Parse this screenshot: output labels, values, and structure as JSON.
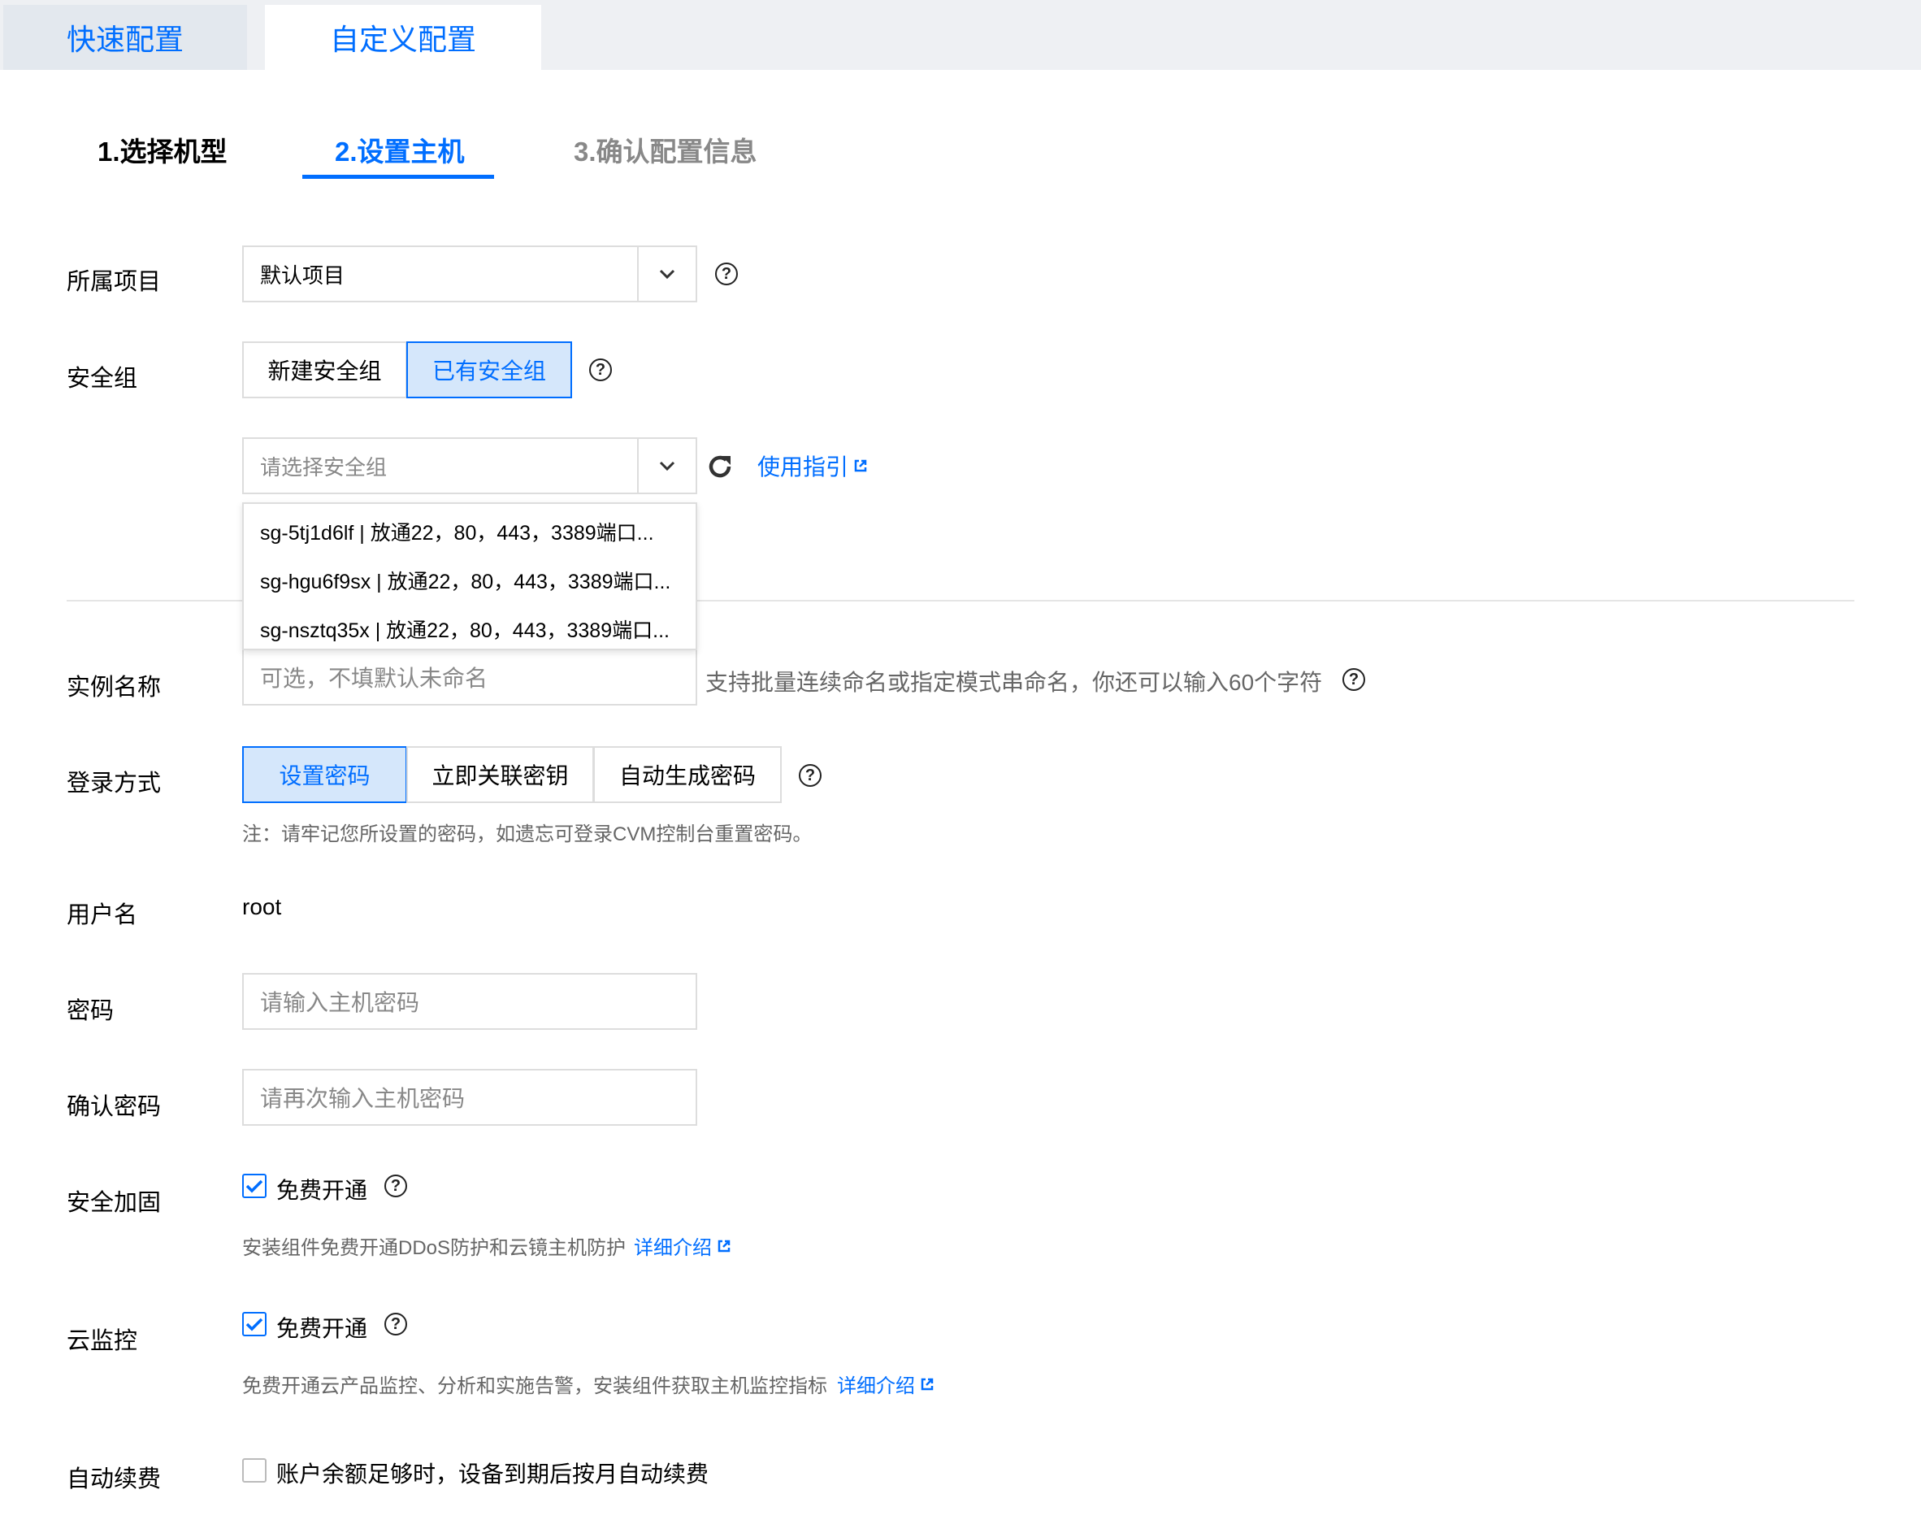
{
  "tabs": [
    {
      "label": "快速配置",
      "active": false
    },
    {
      "label": "自定义配置",
      "active": true
    }
  ],
  "steps": [
    {
      "label": "1.选择机型",
      "state": "done"
    },
    {
      "label": "2.设置主机",
      "state": "active"
    },
    {
      "label": "3.确认配置信息",
      "state": "pending"
    }
  ],
  "project": {
    "label": "所属项目",
    "value": "默认项目"
  },
  "security_group": {
    "label": "安全组",
    "options": [
      "新建安全组",
      "已有安全组"
    ],
    "selected": "已有安全组",
    "select_placeholder": "请选择安全组",
    "guide_link": "使用指引",
    "dropdown_items": [
      "sg-5tj1d6lf | 放通22，80，443，3389端口...",
      "sg-hgu6f9sx | 放通22，80，443，3389端口...",
      "sg-nsztq35x | 放通22，80，443，3389端口..."
    ]
  },
  "instance_name": {
    "label": "实例名称",
    "placeholder": "可选，不填默认未命名",
    "hint": "支持批量连续命名或指定模式串命名，你还可以输入60个字符"
  },
  "login": {
    "label": "登录方式",
    "options": [
      "设置密码",
      "立即关联密钥",
      "自动生成密码"
    ],
    "selected": "设置密码",
    "note": "注：请牢记您所设置的密码，如遗忘可登录CVM控制台重置密码。"
  },
  "username": {
    "label": "用户名",
    "value": "root"
  },
  "password": {
    "label": "密码",
    "placeholder": "请输入主机密码"
  },
  "confirm_password": {
    "label": "确认密码",
    "placeholder": "请再次输入主机密码"
  },
  "security_hardening": {
    "label": "安全加固",
    "checkbox_label": "免费开通",
    "checked": true,
    "desc": "安装组件免费开通DDoS防护和云镜主机防护",
    "link": "详细介绍"
  },
  "cloud_monitor": {
    "label": "云监控",
    "checkbox_label": "免费开通",
    "checked": true,
    "desc": "免费开通云产品监控、分析和实施告警，安装组件获取主机监控指标",
    "link": "详细介绍"
  },
  "auto_renew": {
    "label": "自动续费",
    "checkbox_label": "账户余额足够时，设备到期后按月自动续费",
    "checked": false
  },
  "colors": {
    "accent": "#006eff",
    "selected_bg": "#d5e7fb",
    "border": "#dddddd"
  }
}
